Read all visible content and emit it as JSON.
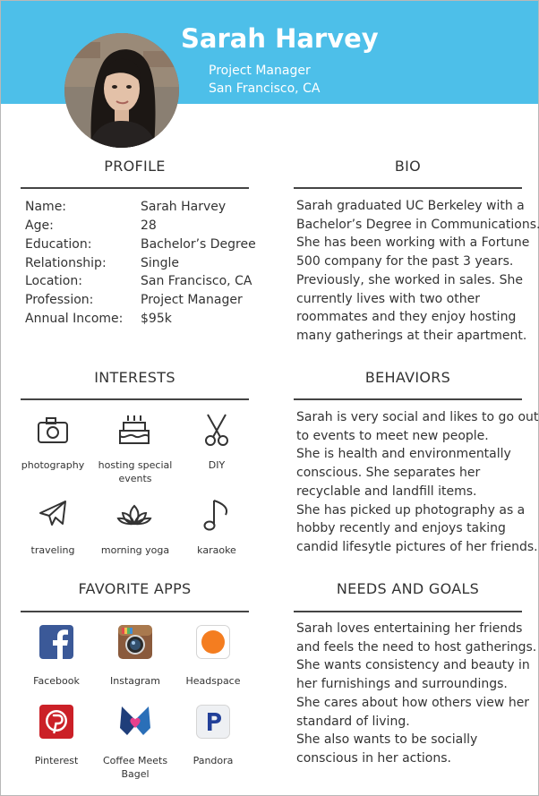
{
  "header": {
    "name": "Sarah Harvey",
    "title": "Project Manager",
    "location": "San Francisco, CA",
    "banner_color": "#4dbfe9"
  },
  "profile": {
    "heading": "PROFILE",
    "rows": [
      {
        "label": "Name:",
        "value": "Sarah Harvey"
      },
      {
        "label": "Age:",
        "value": "28"
      },
      {
        "label": "Education:",
        "value": "Bachelor’s Degree"
      },
      {
        "label": "Relationship:",
        "value": "Single"
      },
      {
        "label": "Location:",
        "value": "San Francisco, CA"
      },
      {
        "label": "Profession:",
        "value": "Project Manager"
      },
      {
        "label": "Annual Income:",
        "value": "$95k"
      }
    ]
  },
  "bio": {
    "heading": "BIO",
    "lines": [
      "Sarah graduated UC Berkeley with a",
      "Bachelor’s Degree in Communications.",
      "She has been working with a Fortune",
      "500 company for the past 3 years.",
      "Previously, she worked in sales. She",
      "currently lives with two other",
      "roommates and they enjoy hosting",
      "many gatherings at their apartment."
    ]
  },
  "interests": {
    "heading": "INTERESTS",
    "items": [
      {
        "label": "photography",
        "icon": "camera-icon"
      },
      {
        "label": "hosting special events",
        "icon": "cake-icon"
      },
      {
        "label": "DIY",
        "icon": "scissors-icon"
      },
      {
        "label": "traveling",
        "icon": "airplane-icon"
      },
      {
        "label": "morning yoga",
        "icon": "lotus-icon"
      },
      {
        "label": "karaoke",
        "icon": "music-note-icon"
      }
    ]
  },
  "behaviors": {
    "heading": "BEHAVIORS",
    "lines": [
      "Sarah is very social and likes to go out",
      "to events to meet new people.",
      "She is health and environmentally",
      "conscious. She separates her",
      "recyclable and landfill items.",
      "She has picked up photography as a",
      "hobby recently and enjoys taking",
      "candid lifesytle pictures of her friends."
    ]
  },
  "apps": {
    "heading": "FAVORITE APPS",
    "items": [
      {
        "label": "Facebook",
        "icon": "facebook-icon",
        "color": "#3b5998"
      },
      {
        "label": "Instagram",
        "icon": "instagram-icon",
        "color": "#8a5a3c"
      },
      {
        "label": "Headspace",
        "icon": "headspace-icon",
        "color": "#f47d20"
      },
      {
        "label": "Pinterest",
        "icon": "pinterest-icon",
        "color": "#cb2027"
      },
      {
        "label": "Coffee Meets Bagel",
        "icon": "coffee-meets-bagel-icon",
        "color": "#2a6fb8"
      },
      {
        "label": "Pandora",
        "icon": "pandora-icon",
        "color": "#224099"
      }
    ]
  },
  "needs": {
    "heading": "NEEDS AND GOALS",
    "lines": [
      "Sarah loves entertaining her friends",
      "and feels the need to host gatherings.",
      "She wants consistency and beauty in",
      "her furnishings and surroundings.",
      "She cares about how others view her",
      "standard of living.",
      "She also wants to be socially",
      "conscious in her actions."
    ]
  }
}
